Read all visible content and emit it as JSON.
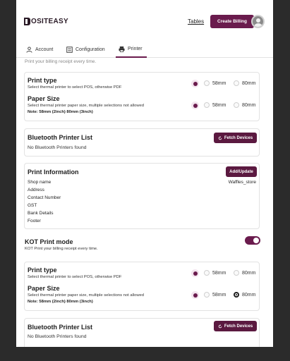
{
  "header": {
    "logo_text": "OSITEASY",
    "tables_link": "Tables",
    "create_billing_button": "Create Billing"
  },
  "tabs": [
    {
      "label": "Account",
      "icon": "user-icon"
    },
    {
      "label": "Configuration",
      "icon": "config-icon"
    },
    {
      "label": "Printer",
      "icon": "printer-icon",
      "active": true
    }
  ],
  "clipped_text": "Print your billing receipt every time.",
  "section1": {
    "print_type": {
      "title": "Print type",
      "description": "Select thermal printer to select POS, otherwise PDF",
      "option_58": "58mm",
      "option_80": "80mm"
    },
    "paper_size": {
      "title": "Paper Size",
      "description": "Select thermal printer paper size, multiple selections not allowed",
      "note": "Note: 58mm (2inch) 80mm (3inch)",
      "option_58": "58mm",
      "option_80": "80mm"
    },
    "bluetooth": {
      "title": "Bluetooth Printer List",
      "fetch_button": "Fetch Devices",
      "empty_text": "No Bluetooth Printers found"
    }
  },
  "print_information": {
    "title": "Print Information",
    "add_update_button": "Add/Update",
    "rows": [
      {
        "label": "Shop name",
        "value": "Waffles_store"
      },
      {
        "label": "Address",
        "value": ""
      },
      {
        "label": "Contact Number",
        "value": ""
      },
      {
        "label": "GST",
        "value": ""
      },
      {
        "label": "Bank Details",
        "value": ""
      },
      {
        "label": "Footer",
        "value": ""
      }
    ]
  },
  "kot": {
    "title": "KOT Print mode",
    "description": "KOT Print your billing receipt every time.",
    "enabled": true
  },
  "section2": {
    "print_type": {
      "title": "Print type",
      "description": "Select thermal printer to select POS, otherwise PDF",
      "option_58": "58mm",
      "option_80": "80mm"
    },
    "paper_size": {
      "title": "Paper Size",
      "description": "Select thermal printer paper size, multiple selections not allowed",
      "note": "Note: 58mm (2inch) 80mm (3inch)",
      "option_58": "58mm",
      "option_80": "80mm",
      "selected": "80mm"
    },
    "bluetooth": {
      "title": "Bluetooth Printer List",
      "fetch_button": "Fetch Devices",
      "empty_text": "No Bluetooth Printers found"
    }
  },
  "colors": {
    "accent": "#6a1b4d",
    "accent_light": "#f3e4ee",
    "background_outer": "#2b2b2b"
  }
}
